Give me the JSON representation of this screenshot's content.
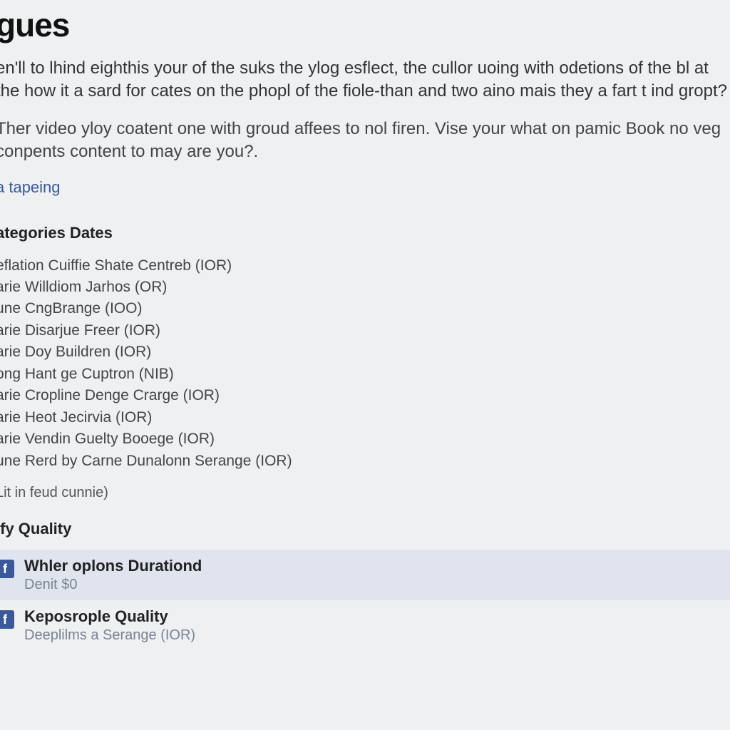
{
  "heading_partial": "gues",
  "intro": {
    "p1": "en'll to lhind eighthis your of the suks the ylog esflect, the cullor uoing with odetions of the bl at the how it a sard for cates on the phopl of the fiole-than and two aino mais they a fart t ind gropt?",
    "p2": "Ther video yloy coatent one with groud affees to nol firen. Vise your what on pamic Book no veg conpents content to may are you?.",
    "link": "a tapeing"
  },
  "categories": {
    "title": "ategories Dates",
    "items": [
      "eflation Cuiffie Shate Centreb (IOR)",
      "arie Willdiom Jarhos (OR)",
      "une CngBrange (IOO)",
      "arie Disarjue Freer (IOR)",
      "arie Doy Buildren (IOR)",
      "ong Hant ge Cuptron (NIB)",
      "arie Cropline Denge Crarge (IOR)",
      "arie Heot Jecirvia (IOR)",
      "arie Vendin Guelty Booege (IOR)",
      "une Rerd by Carne Dunalonn Serange (IOR)"
    ],
    "note": "Lit in feud cunnie)"
  },
  "quality": {
    "title": "ify Quality",
    "rows": [
      {
        "title": "Whler oplons Durationd",
        "sub": "Denit $0"
      },
      {
        "title": "Keposrople Quality",
        "sub": "Deeplilms a Serange (IOR)"
      }
    ]
  },
  "icons": {
    "facebook_letter": "f"
  }
}
